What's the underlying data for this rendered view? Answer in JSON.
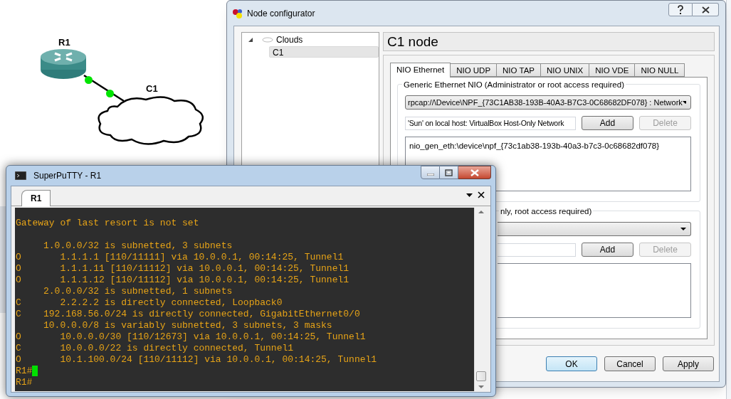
{
  "topology": {
    "nodes": [
      {
        "label": "R1",
        "kind": "router"
      },
      {
        "label": "C1",
        "kind": "cloud"
      }
    ]
  },
  "node_configurator": {
    "title": "Node configurator",
    "tree": [
      {
        "label": "Clouds",
        "expanded": true,
        "children": [
          {
            "label": "C1",
            "selected": true
          }
        ]
      }
    ],
    "header": "C1 node",
    "tabs": [
      {
        "label": "NIO Ethernet",
        "selected": true
      },
      {
        "label": "NIO UDP",
        "selected": false
      },
      {
        "label": "NIO TAP",
        "selected": false
      },
      {
        "label": "NIO UNIX",
        "selected": false
      },
      {
        "label": "NIO VDE",
        "selected": false
      },
      {
        "label": "NIO NULL",
        "selected": false
      }
    ],
    "groups": [
      {
        "title": "Generic Ethernet NIO (Administrator or root access required)",
        "combo_value": "rpcap://\\Device\\NPF_{73C1AB38-193B-40A3-B7C3-0C68682DF078} : Network",
        "field_value": "'Sun' on local host: VirtualBox Host-Only Network",
        "buttons": [
          {
            "label": "Add",
            "disabled": false
          },
          {
            "label": "Delete",
            "disabled": true
          }
        ],
        "items": [
          "nio_gen_eth:\\device\\npf_{73c1ab38-193b-40a3-b7c3-0c68682df078}"
        ]
      },
      {
        "title": "nly, root access required)",
        "buttons": [
          {
            "label": "Add",
            "disabled": false
          },
          {
            "label": "Delete",
            "disabled": true
          }
        ]
      }
    ],
    "footer_buttons": [
      {
        "label": "OK",
        "default": true
      },
      {
        "label": "Cancel",
        "default": false
      },
      {
        "label": "Apply",
        "default": false
      }
    ]
  },
  "superputty": {
    "title": "SuperPuTTY - R1",
    "tabs": [
      {
        "label": "R1",
        "selected": true
      }
    ],
    "terminal_blocks": [
      [
        {
          "text": "Gateway of last resort is not set",
          "cursor": false
        }
      ],
      [
        {
          "text": "     1.0.0.0/32 is subnetted, 3 subnets",
          "cursor": false
        },
        {
          "text": "O       1.1.1.1 [110/11111] via 10.0.0.1, 00:14:25, Tunnel1",
          "cursor": false
        },
        {
          "text": "O       1.1.1.11 [110/11112] via 10.0.0.1, 00:14:25, Tunnel1",
          "cursor": false
        },
        {
          "text": "O       1.1.1.12 [110/11112] via 10.0.0.1, 00:14:25, Tunnel1",
          "cursor": false
        },
        {
          "text": "     2.0.0.0/32 is subnetted, 1 subnets",
          "cursor": false
        },
        {
          "text": "C       2.2.2.2 is directly connected, Loopback0",
          "cursor": false
        },
        {
          "text": "C    192.168.56.0/24 is directly connected, GigabitEthernet0/0",
          "cursor": false
        },
        {
          "text": "     10.0.0.0/8 is variably subnetted, 3 subnets, 3 masks",
          "cursor": false
        },
        {
          "text": "O       10.0.0.0/30 [110/12673] via 10.0.0.1, 00:14:25, Tunnel1",
          "cursor": false
        },
        {
          "text": "C       10.0.0.0/22 is directly connected, Tunnel1",
          "cursor": false
        },
        {
          "text": "O       10.1.100.0/24 [110/11112] via 10.0.0.1, 00:14:25, Tunnel1",
          "cursor": false
        },
        {
          "text": "R1#",
          "cursor": true
        },
        {
          "text": "R1#",
          "cursor": false
        }
      ]
    ]
  }
}
